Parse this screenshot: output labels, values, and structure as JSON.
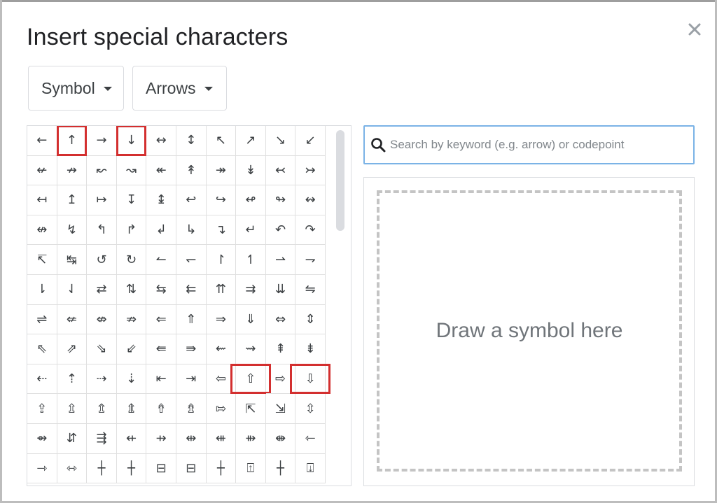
{
  "dialog": {
    "title": "Insert special characters"
  },
  "category_dropdown": {
    "label": "Symbol"
  },
  "subcategory_dropdown": {
    "label": "Arrows"
  },
  "search": {
    "placeholder": "Search by keyword (e.g. arrow) or codepoint",
    "value": ""
  },
  "draw": {
    "hint": "Draw a symbol here"
  },
  "colors": {
    "highlight": "#d32f2f",
    "search_border": "#7bb3e6"
  },
  "characters": [
    [
      "←",
      "↑",
      "→",
      "↓",
      "↔",
      "↕",
      "↖",
      "↗",
      "↘",
      "↙"
    ],
    [
      "↚",
      "↛",
      "↜",
      "↝",
      "↞",
      "↟",
      "↠",
      "↡",
      "↢",
      "↣"
    ],
    [
      "↤",
      "↥",
      "↦",
      "↧",
      "↨",
      "↩",
      "↪",
      "↫",
      "↬",
      "↭"
    ],
    [
      "↮",
      "↯",
      "↰",
      "↱",
      "↲",
      "↳",
      "↴",
      "↵",
      "↶",
      "↷"
    ],
    [
      "↸",
      "↹",
      "↺",
      "↻",
      "↼",
      "↽",
      "↾",
      "↿",
      "⇀",
      "⇁"
    ],
    [
      "⇂",
      "⇃",
      "⇄",
      "⇅",
      "⇆",
      "⇇",
      "⇈",
      "⇉",
      "⇊",
      "⇋"
    ],
    [
      "⇌",
      "⇍",
      "⇎",
      "⇏",
      "⇐",
      "⇑",
      "⇒",
      "⇓",
      "⇔",
      "⇕"
    ],
    [
      "⇖",
      "⇗",
      "⇘",
      "⇙",
      "⇚",
      "⇛",
      "⇜",
      "⇝",
      "⇞",
      "⇟"
    ],
    [
      "⇠",
      "⇡",
      "⇢",
      "⇣",
      "⇤",
      "⇥",
      "⇦",
      "⇧",
      "⇨",
      "⇩"
    ],
    [
      "⇪",
      "⇫",
      "⇬",
      "⇭",
      "⇮",
      "⇯",
      "⇰",
      "⇱",
      "⇲",
      "⇳"
    ],
    [
      "⇴",
      "⇵",
      "⇶",
      "⇷",
      "⇸",
      "⇹",
      "⇺",
      "⇻",
      "⇼",
      "⇽"
    ],
    [
      "⇾",
      "⇿",
      "┼",
      "┼",
      "⊟",
      "⊟",
      "┼",
      "⍐",
      "┼",
      "⍗"
    ]
  ],
  "highlighted_characters": [
    "↑",
    "↓",
    "⇧",
    "⇩"
  ]
}
